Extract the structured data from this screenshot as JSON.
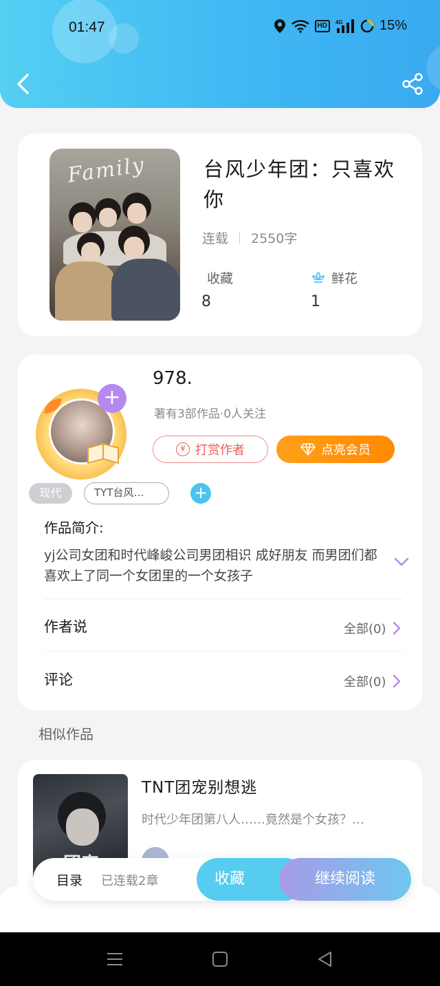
{
  "status_bar": {
    "time": "01:47",
    "battery": "15%",
    "hd_badge": "HD",
    "network": "4G"
  },
  "book": {
    "title": "台风少年团：只喜欢你",
    "status": "连载",
    "word_count": "2550字",
    "collect_label": "收藏",
    "collect_count": "8",
    "flower_label": "鲜花",
    "flower_count": "1",
    "cover_text": "Family"
  },
  "author": {
    "name": "978.",
    "info": "著有3部作品·0人关注",
    "tip_label": "打赏作者",
    "vip_label": "点亮会员",
    "tip_icon_glyph": "¥"
  },
  "tags": {
    "genre": "现代",
    "series": "TYT台风…"
  },
  "intro": {
    "label": "作品简介:",
    "text": "yj公司女团和时代峰峻公司男团相识 成好朋友 而男团们都喜欢上了同一个女团里的一个女孩子"
  },
  "author_says": {
    "label": "作者说",
    "more": "全部(0)"
  },
  "comments": {
    "label": "评论",
    "more": "全部(0)"
  },
  "similar": {
    "section_title": "相似作品",
    "items": [
      {
        "title": "TNT团宠别想逃",
        "desc": "时代少年团第八人……竟然是个女孩？…",
        "cover_text": "团宠"
      }
    ]
  },
  "action_bar": {
    "catalog": "目录",
    "chapters": "已连载2章",
    "collect": "收藏",
    "read": "继续阅读"
  },
  "colors": {
    "header_start": "#54cff2",
    "header_end": "#3aaaf0",
    "vip_orange": "#ff8a00",
    "tip_red": "#e9605a",
    "accent_blue": "#4cc3f0",
    "accent_purple": "#b48af0"
  }
}
